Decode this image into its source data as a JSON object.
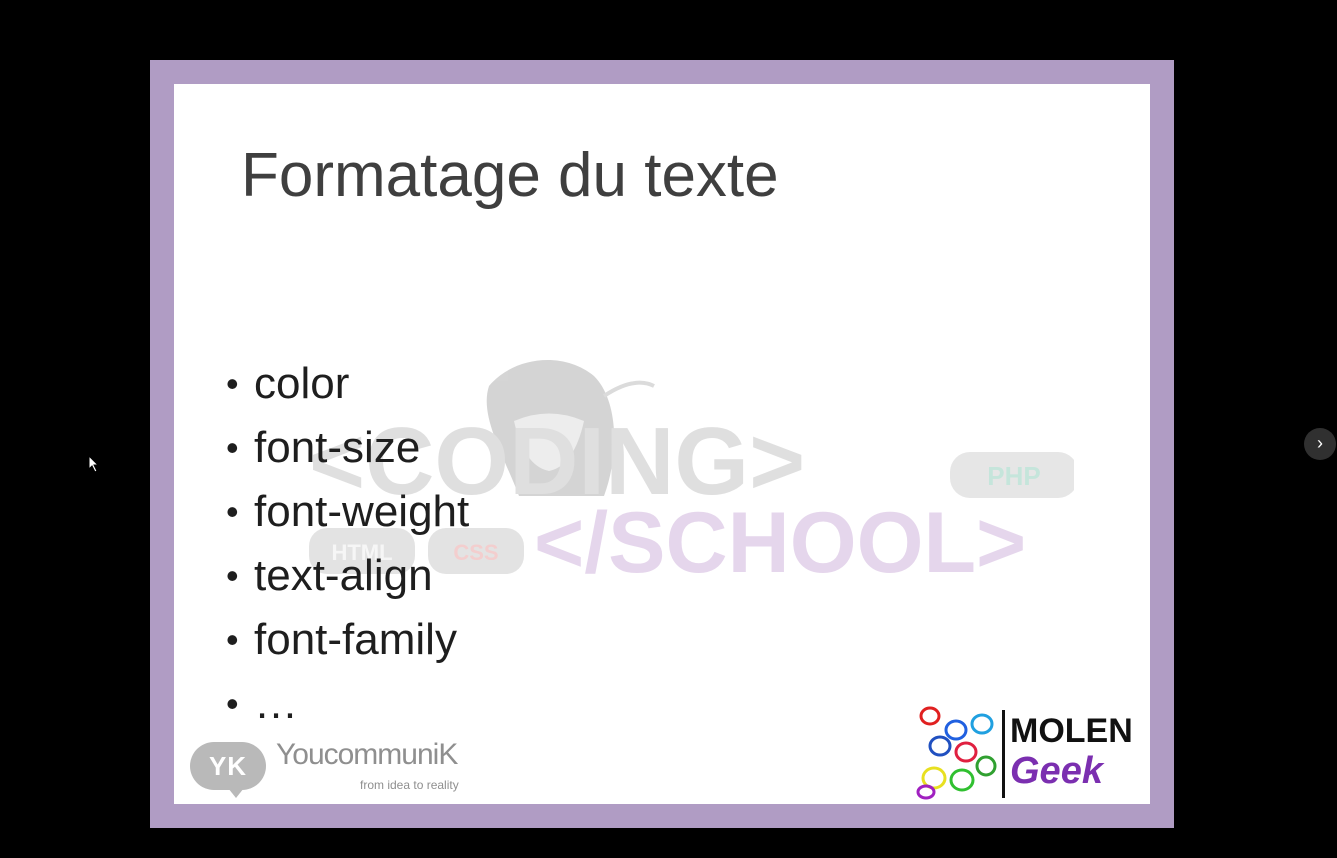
{
  "slide": {
    "title": "Formatage du texte",
    "bullets": [
      "color",
      "font-size",
      "font-weight",
      "text-align",
      "font-family",
      "…"
    ],
    "bullet_glyph": "•"
  },
  "watermark": {
    "coding": "<CODING>",
    "school": "</SCHOOL>",
    "html": "HTML",
    "css": "CSS",
    "php": "PHP"
  },
  "logos": {
    "youcommunik": {
      "badge": "YK",
      "name": "YoucommuniK",
      "tagline": "from idea to reality"
    },
    "molengeek": {
      "line1": "MOLEN",
      "line2": "Geek"
    }
  },
  "controls": {
    "next_glyph": "›"
  },
  "colors": {
    "frame": "#b09cc4",
    "background": "#000000",
    "title": "#3f3f3f",
    "school": "#e3d2ea"
  }
}
